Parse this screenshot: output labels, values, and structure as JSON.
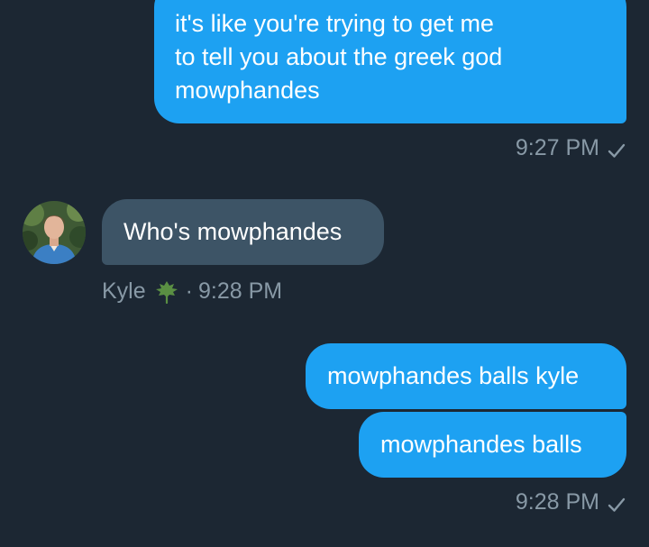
{
  "messages": [
    {
      "direction": "outgoing",
      "text": "it's like you're trying to get me\nto tell you about the greek god\nmowphandes"
    },
    {
      "direction": "incoming",
      "text": "Who's mowphandes"
    },
    {
      "direction": "outgoing",
      "text": "mowphandes balls kyle"
    },
    {
      "direction": "outgoing",
      "text": "mowphandes balls"
    }
  ],
  "meta": {
    "outgoing_time_1": "9:27 PM",
    "incoming_sender": "Kyle",
    "incoming_separator": "·",
    "incoming_time": "9:28 PM",
    "outgoing_time_2": "9:28 PM"
  },
  "icons": {
    "sent_indicator": "check-icon",
    "sender_badge": "leaf-icon",
    "avatar": "avatar"
  },
  "colors": {
    "background": "#1c2733",
    "outgoing_bubble": "#1da1f2",
    "incoming_bubble": "#3d5466",
    "meta_text": "#8899a6",
    "message_text": "#ffffff",
    "leaf": "#4a7a3a"
  }
}
